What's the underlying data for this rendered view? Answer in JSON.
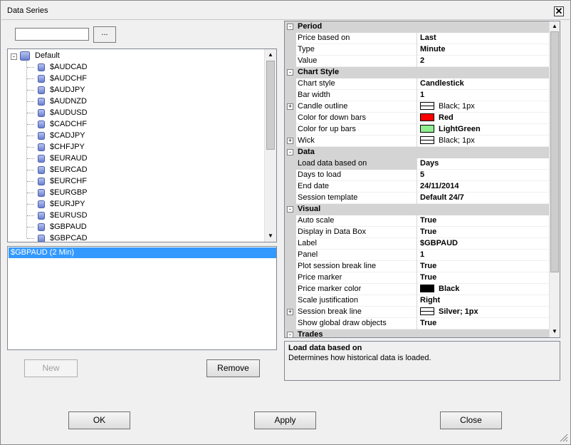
{
  "window": {
    "title": "Data Series",
    "close_label": "✕"
  },
  "search": {
    "value": "",
    "browse_label": "..."
  },
  "tree": {
    "root_label": "Default",
    "items": [
      "$AUDCAD",
      "$AUDCHF",
      "$AUDJPY",
      "$AUDNZD",
      "$AUDUSD",
      "$CADCHF",
      "$CADJPY",
      "$CHFJPY",
      "$EURAUD",
      "$EURCAD",
      "$EURCHF",
      "$EURGBP",
      "$EURJPY",
      "$EURUSD",
      "$GBPAUD",
      "$GBPCAD"
    ]
  },
  "selected_series": [
    "$GBPAUD (2 Min)"
  ],
  "buttons": {
    "new": "New",
    "remove": "Remove",
    "ok": "OK",
    "apply": "Apply",
    "close": "Close"
  },
  "properties": [
    {
      "type": "cat",
      "label": "Period",
      "expander": "-"
    },
    {
      "name": "Price based on",
      "value": "Last"
    },
    {
      "name": "Type",
      "value": "Minute"
    },
    {
      "name": "Value",
      "value": "2"
    },
    {
      "type": "cat",
      "label": "Chart Style",
      "expander": "-"
    },
    {
      "name": "Chart style",
      "value": "Candlestick"
    },
    {
      "name": "Bar width",
      "value": "1"
    },
    {
      "name": "Candle outline",
      "value": "Black; 1px",
      "swatch": "line",
      "expander": "+"
    },
    {
      "name": "Color for down bars",
      "value": "Red",
      "swatch": "#ff0000"
    },
    {
      "name": "Color for up bars",
      "value": "LightGreen",
      "swatch": "#90ee90"
    },
    {
      "name": "Wick",
      "value": "Black; 1px",
      "swatch": "line",
      "expander": "+"
    },
    {
      "type": "cat",
      "label": "Data",
      "expander": "-"
    },
    {
      "name": "Load data based on",
      "value": "Days",
      "selected": true
    },
    {
      "name": "Days to load",
      "value": "5"
    },
    {
      "name": "End date",
      "value": "24/11/2014"
    },
    {
      "name": "Session template",
      "value": "Default 24/7"
    },
    {
      "type": "cat",
      "label": "Visual",
      "expander": "-"
    },
    {
      "name": "Auto scale",
      "value": "True"
    },
    {
      "name": "Display in Data Box",
      "value": "True"
    },
    {
      "name": "Label",
      "value": "$GBPAUD"
    },
    {
      "name": "Panel",
      "value": "1"
    },
    {
      "name": "Plot session break line",
      "value": "True"
    },
    {
      "name": "Price marker",
      "value": "True"
    },
    {
      "name": "Price marker color",
      "value": "Black",
      "swatch": "#000000"
    },
    {
      "name": "Scale justification",
      "value": "Right"
    },
    {
      "name": "Session break line",
      "value": "Silver; 1px",
      "swatch": "line",
      "expander": "+"
    },
    {
      "name": "Show global draw objects",
      "value": "True"
    },
    {
      "type": "cat",
      "label": "Trades",
      "expander": "-"
    }
  ],
  "description": {
    "title": "Load data based on",
    "text": "Determines how historical data is loaded."
  },
  "colors": {
    "selection": "#3399ff",
    "category_bg": "#d4d4d4"
  }
}
